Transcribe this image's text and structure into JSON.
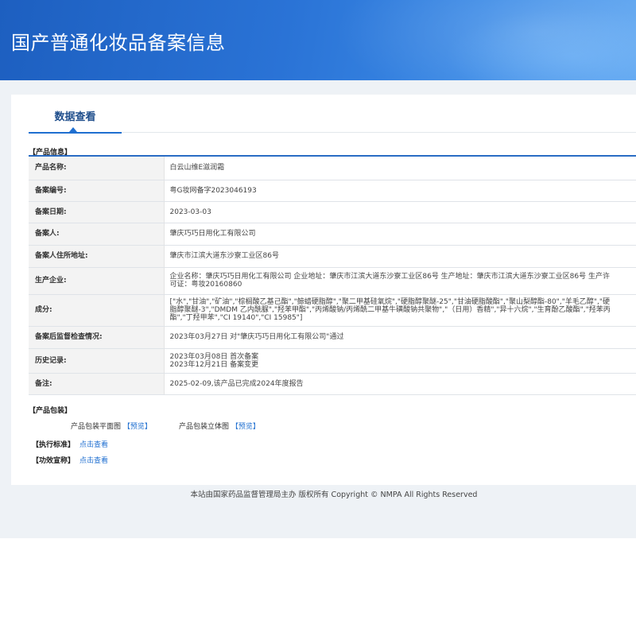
{
  "banner": {
    "title": "国产普通化妆品备案信息"
  },
  "tab": {
    "label": "数据查看"
  },
  "product_info": {
    "section_label": "【产品信息】",
    "rows": [
      {
        "key": "产品名称:",
        "value": "白云山维E滋润霜"
      },
      {
        "key": "备案编号:",
        "value": "粤G妆网备字2023046193"
      },
      {
        "key": "备案日期:",
        "value": "2023-03-03"
      },
      {
        "key": "备案人:",
        "value": "肇庆巧巧日用化工有限公司"
      },
      {
        "key": "备案人住所地址:",
        "value": "肇庆市江滨大道东沙寮工业区86号"
      },
      {
        "key": "生产企业:",
        "value": "企业名称：肇庆巧巧日用化工有限公司 企业地址：肇庆市江滨大道东沙寮工业区86号 生产地址：肇庆市江滨大道东沙寮工业区86号 生产许可证：粤妆20160860"
      },
      {
        "key": "成分:",
        "value": "[\"水\",\"甘油\",\"矿油\",\"棕榈酸乙基己酯\",\"鲸蜡硬脂醇\",\"聚二甲基硅氧烷\",\"硬脂醇聚醚-25\",\"甘油硬脂酸酯\",\"聚山梨醇酯-80\",\"羊毛乙醇\",\"硬脂醇聚醚-3\",\"DMDM 乙内酰脲\",\"羟苯甲酯\",\"丙烯酸钠/丙烯酰二甲基牛磺酸钠共聚物\",\"（日用）香精\",\"异十六烷\",\"生育酚乙酸酯\",\"羟苯丙酯\",\"丁羟甲苯\",\"CI 19140\",\"CI 15985\"]"
      },
      {
        "key": "备案后监督检查情况:",
        "value": "2023年03月27日 对\"肇庆巧巧日用化工有限公司\"通过"
      },
      {
        "key": "历史记录:",
        "value": "2023年03月08日 首次备案\n2023年12月21日 备案变更"
      },
      {
        "key": "备注:",
        "value": "2025-02-09,该产品已完成2024年度报告"
      }
    ]
  },
  "packaging": {
    "section_label": "【产品包装】",
    "flat_label": "产品包装平面图",
    "flat_link": "【预览】",
    "solid_label": "产品包装立体图",
    "solid_link": "【预览】"
  },
  "standard": {
    "label": "【执行标准】",
    "link": "点击查看"
  },
  "efficacy": {
    "label": "【功效宣称】",
    "link": "点击查看"
  },
  "footer": {
    "text": "本站由国家药品监督管理局主办 版权所有 Copyright © NMPA All Rights Reserved"
  }
}
